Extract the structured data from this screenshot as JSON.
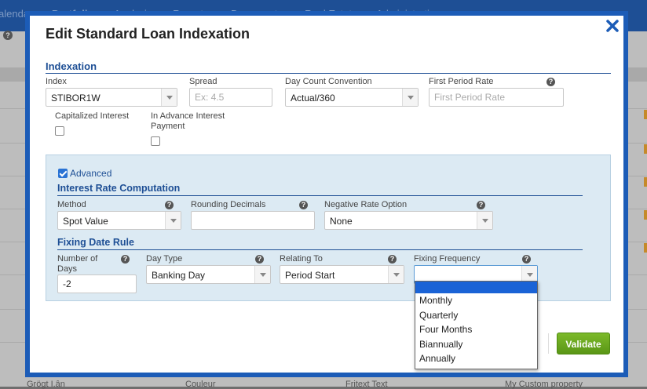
{
  "background": {
    "nav": [
      "alenda",
      "Portfolio",
      "Analysis",
      "Reports",
      "Documents",
      "Real Estate",
      "Administration ▾"
    ],
    "help_glyph": "?",
    "footer": [
      "Grögt I.ân",
      "Couleur",
      "Fritext Text",
      "My Custom property"
    ]
  },
  "modal": {
    "title": "Edit Standard Loan Indexation",
    "close_icon": "close-x-icon",
    "help_glyph": "?"
  },
  "indexation": {
    "section_title": "Indexation",
    "index": {
      "label": "Index",
      "value": "STIBOR1W"
    },
    "spread": {
      "label": "Spread",
      "placeholder": "Ex: 4.5"
    },
    "day_count": {
      "label": "Day Count Convention",
      "value": "Actual/360"
    },
    "first_period_rate": {
      "label": "First Period Rate",
      "placeholder": "First Period Rate"
    },
    "capitalized_interest": {
      "label": "Capitalized Interest",
      "checked": false
    },
    "in_advance": {
      "label_line1": "In Advance Interest",
      "label_line2": "Payment",
      "checked": false
    }
  },
  "advanced": {
    "toggle_label": "Advanced",
    "checked": true,
    "interest_title": "Interest Rate Computation",
    "method": {
      "label": "Method",
      "value": "Spot Value"
    },
    "rounding": {
      "label": "Rounding Decimals",
      "value": ""
    },
    "negative_rate": {
      "label": "Negative Rate Option",
      "value": "None"
    },
    "fixing_title": "Fixing Date Rule",
    "number_of_days": {
      "label_line1": "Number of",
      "label_line2": "Days",
      "value": "-2"
    },
    "day_type": {
      "label": "Day Type",
      "value": "Banking Day"
    },
    "relating_to": {
      "label": "Relating To",
      "value": "Period Start"
    },
    "fixing_frequency": {
      "label": "Fixing Frequency",
      "value": "",
      "options": [
        "",
        "Monthly",
        "Quarterly",
        "Four Months",
        "Biannually",
        "Annually"
      ]
    }
  },
  "footer": {
    "validate_label": "Validate"
  },
  "colors": {
    "accent": "#1c5cb7",
    "validate": "#5a9616",
    "panel": "#dceaf3"
  }
}
